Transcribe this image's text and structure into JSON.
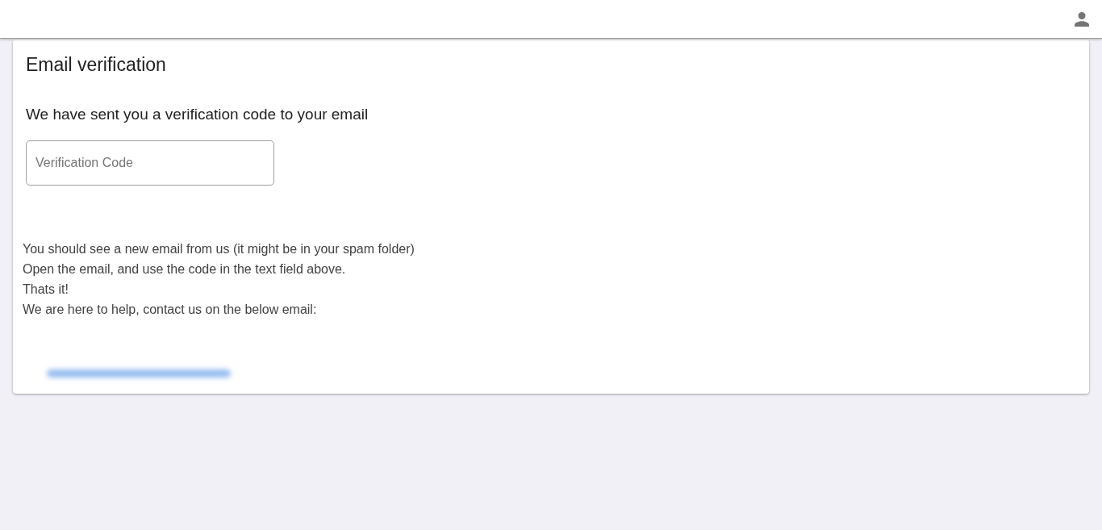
{
  "card": {
    "title": "Email verification",
    "subtitle": "We have sent you a verification code to your email",
    "verification_field": {
      "placeholder": "Verification Code"
    },
    "instructions": [
      "You should see a new email from us (it might be in your spam folder)",
      "Open the email, and use the code in the text field above.",
      "Thats it!",
      "We are here to help, contact us on the below email:"
    ]
  }
}
